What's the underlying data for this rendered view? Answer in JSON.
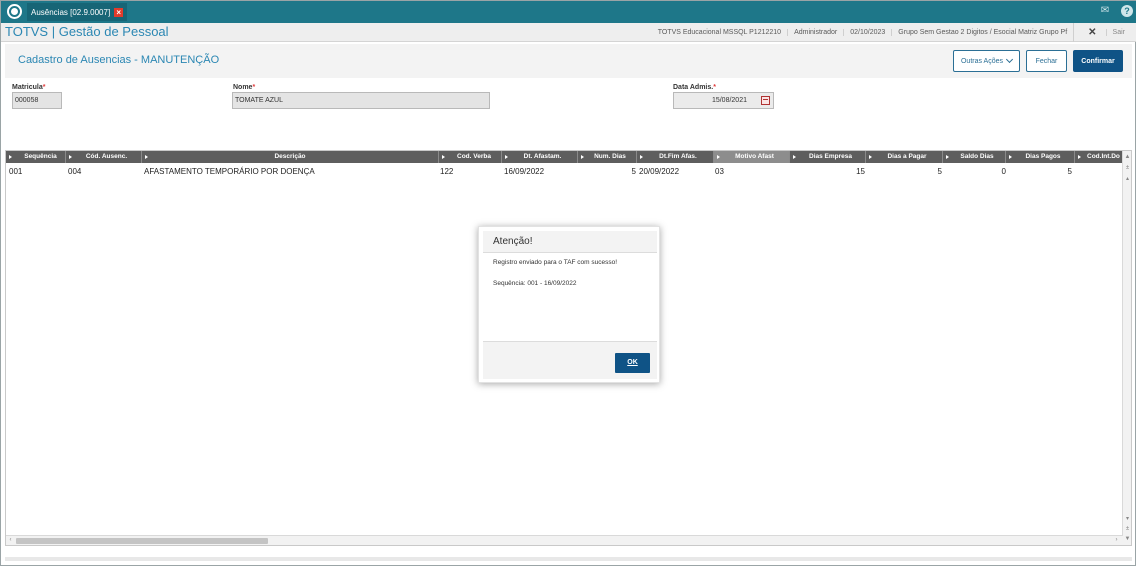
{
  "window": {
    "tab_label": "Ausências [02.9.0007]"
  },
  "header": {
    "brand": "TOTVS | Gestão de Pessoal",
    "env": "TOTVS Educacional MSSQL P1212210",
    "user": "Administrador",
    "date": "02/10/2023",
    "company": "Grupo Sem Gestao 2 Digitos / Esocial Matriz Grupo Pf",
    "sair": "Sair"
  },
  "form": {
    "title": "Cadastro de Ausencias - MANUTENÇÃO",
    "buttons": {
      "outras": "Outras Ações",
      "fechar": "Fechar",
      "confirmar": "Confirmar"
    },
    "required_marker": "*",
    "fields": {
      "matricula_label": "Matricula",
      "matricula_value": "000058",
      "nome_label": "Nome",
      "nome_value": "TOMATE AZUL",
      "data_label": "Data Admis.",
      "data_value": "15/08/2021"
    }
  },
  "grid": {
    "columns": [
      "Sequência",
      "Cód. Ausenc.",
      "Descrição",
      "Cod. Verba",
      "Dt. Afastam.",
      "Num. Dias",
      "Dt.Fim Afas.",
      "Motivo Afast",
      "Dias Empresa",
      "Dias a Pagar",
      "Saldo Dias",
      "Dias Pagos",
      "Cod.Int.Do"
    ],
    "rows": [
      {
        "seq": "001",
        "cod": "004",
        "desc": "AFASTAMENTO TEMPORÁRIO POR DOENÇA",
        "verba": "122",
        "dt_afast": "16/09/2022",
        "num_dias": "5",
        "dt_fim": "20/09/2022",
        "motivo": "03",
        "dias_emp": "15",
        "dias_pagar": "5",
        "saldo": "0",
        "pagos": "5"
      }
    ]
  },
  "dialog": {
    "title": "Atenção!",
    "message": "Registro enviado para o TAF com sucesso!",
    "detail": "Sequência: 001 - 16/09/2022",
    "ok": "OK"
  },
  "icons": {
    "logo": "totvs-logo-icon",
    "close": "close-icon",
    "mail": "mail-icon",
    "help": "help-icon",
    "calendar": "calendar-icon"
  },
  "colors": {
    "titlebar": "#1e7789",
    "brand": "#2b87b3",
    "primary": "#0f5386",
    "grid_header": "#5e5e5e",
    "required": "#e23b3b"
  }
}
